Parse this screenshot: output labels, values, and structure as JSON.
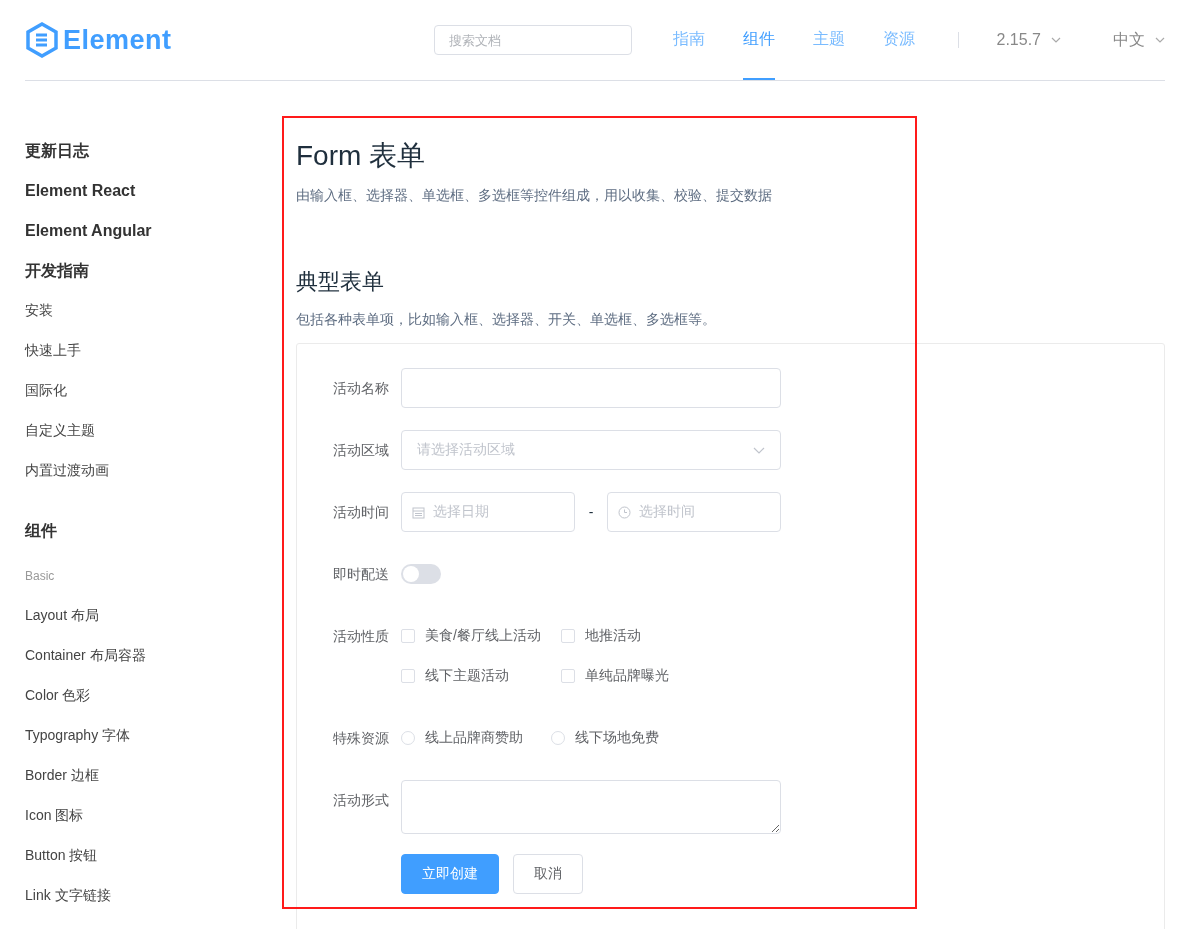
{
  "header": {
    "logo": "Element",
    "search": {
      "placeholder": "搜索文档"
    },
    "nav": [
      {
        "label": "指南",
        "selected": false
      },
      {
        "label": "组件",
        "selected": true
      },
      {
        "label": "主题",
        "selected": false
      },
      {
        "label": "资源",
        "selected": false
      }
    ],
    "version": "2.15.7",
    "language": "中文"
  },
  "sidebar": {
    "items": [
      {
        "kind": "group",
        "label": "更新日志"
      },
      {
        "kind": "group",
        "label": "Element React"
      },
      {
        "kind": "group",
        "label": "Element Angular"
      },
      {
        "kind": "group",
        "label": "开发指南"
      },
      {
        "kind": "link",
        "label": "安装"
      },
      {
        "kind": "link",
        "label": "快速上手"
      },
      {
        "kind": "link",
        "label": "国际化"
      },
      {
        "kind": "link",
        "label": "自定义主题"
      },
      {
        "kind": "link",
        "label": "内置过渡动画"
      },
      {
        "kind": "section",
        "label": "组件"
      },
      {
        "kind": "category",
        "label": "Basic"
      },
      {
        "kind": "link",
        "label": "Layout 布局"
      },
      {
        "kind": "link",
        "label": "Container 布局容器"
      },
      {
        "kind": "link",
        "label": "Color 色彩"
      },
      {
        "kind": "link",
        "label": "Typography 字体"
      },
      {
        "kind": "link",
        "label": "Border 边框"
      },
      {
        "kind": "link",
        "label": "Icon 图标"
      },
      {
        "kind": "link",
        "label": "Button 按钮"
      },
      {
        "kind": "link",
        "label": "Link 文字链接"
      }
    ]
  },
  "page": {
    "title": "Form 表单",
    "description": "由输入框、选择器、单选框、多选框等控件组成，用以收集、校验、提交数据",
    "section_title": "典型表单",
    "section_description": "包括各种表单项，比如输入框、选择器、开关、单选框、多选框等。",
    "form": {
      "fields": [
        {
          "kind": "text",
          "label": "活动名称"
        },
        {
          "kind": "select",
          "label": "活动区域",
          "placeholder": "请选择活动区域"
        },
        {
          "kind": "datetime",
          "label": "活动时间",
          "date_placeholder": "选择日期",
          "separator": "-",
          "time_placeholder": "选择时间"
        },
        {
          "kind": "switch",
          "label": "即时配送",
          "on": false
        },
        {
          "kind": "checkboxes",
          "label": "活动性质",
          "options": [
            {
              "label": "美食/餐厅线上活动",
              "checked": false
            },
            {
              "label": "地推活动",
              "checked": false
            },
            {
              "label": "线下主题活动",
              "checked": false
            },
            {
              "label": "单纯品牌曝光",
              "checked": false
            }
          ]
        },
        {
          "kind": "radios",
          "label": "特殊资源",
          "options": [
            {
              "label": "线上品牌商赞助",
              "selected": false
            },
            {
              "label": "线下场地免费",
              "selected": false
            }
          ]
        },
        {
          "kind": "textarea",
          "label": "活动形式"
        }
      ],
      "buttons": [
        {
          "kind": "primary",
          "label": "立即创建"
        },
        {
          "kind": "default",
          "label": "取消"
        }
      ]
    }
  }
}
